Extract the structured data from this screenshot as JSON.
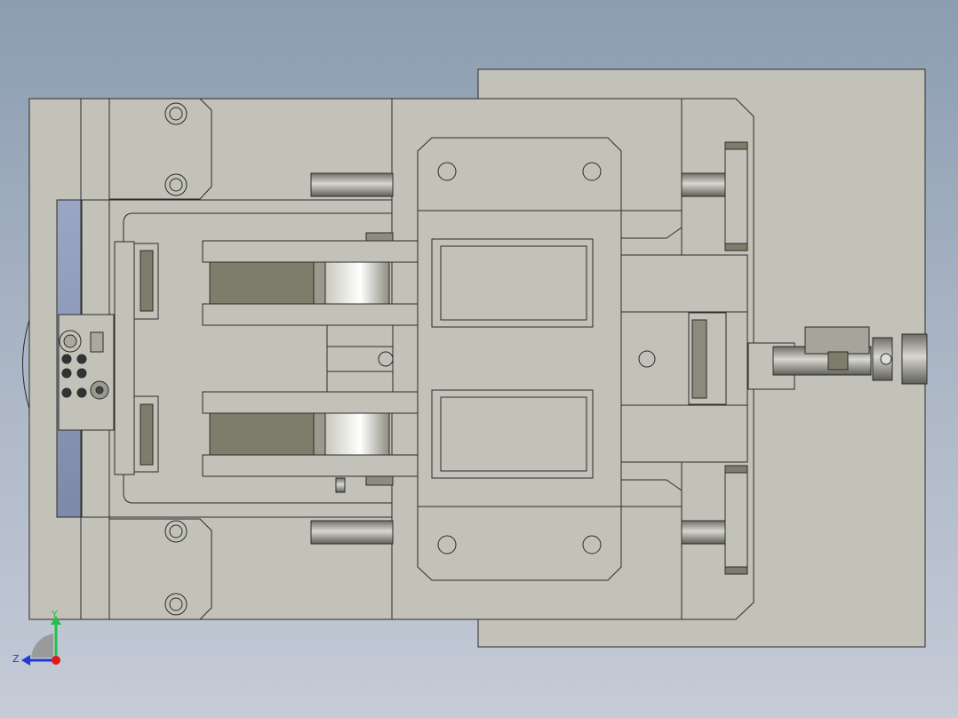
{
  "viewport": {
    "background_top": "#8b9db1",
    "background_bottom": "#c5cbd7",
    "part_color": "#c3c2b8",
    "edge_color": "#2b2b2b",
    "slot_color": "#7e7d6c",
    "rod_color": "#9a9a92"
  },
  "triad": {
    "x_label": "",
    "y_label": "Y",
    "z_label": "Z",
    "y_color": "#22c04a",
    "z_color": "#2438d8",
    "origin_color": "#e01818"
  }
}
